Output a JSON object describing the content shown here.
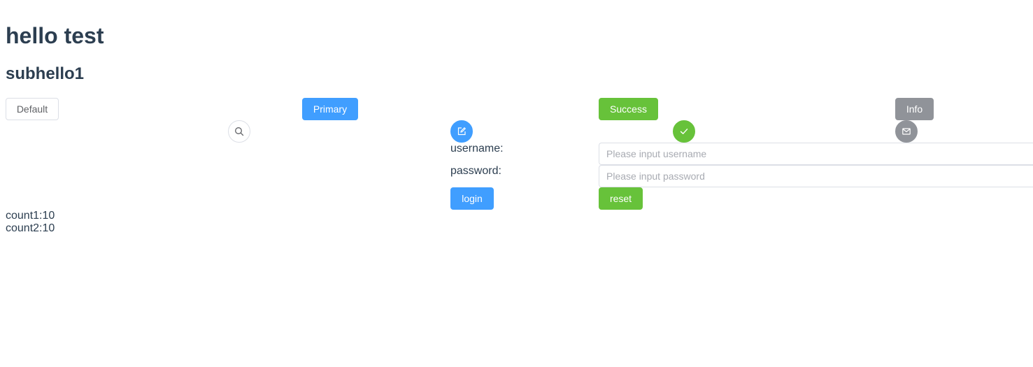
{
  "header": {
    "title": "hello test",
    "subtitle": "subhello1"
  },
  "buttons": {
    "default": "Default",
    "primary": "Primary",
    "success": "Success",
    "info": "Info"
  },
  "icon_buttons": [
    {
      "icon": "search-icon",
      "variant": "default"
    },
    {
      "icon": "edit-icon",
      "variant": "primary"
    },
    {
      "icon": "check-icon",
      "variant": "success"
    },
    {
      "icon": "message-icon",
      "variant": "info"
    }
  ],
  "form": {
    "username_label": "username:",
    "username_placeholder": "Please input username",
    "username_value": "",
    "password_label": "password:",
    "password_placeholder": "Please input password",
    "password_value": "",
    "login_label": "login",
    "reset_label": "reset"
  },
  "counts": {
    "count1": "count1:10",
    "count2": "count2:10"
  },
  "colors": {
    "primary": "#409eff",
    "success": "#67c23a",
    "info": "#909399",
    "text": "#2c3e50",
    "border": "#dcdfe6"
  }
}
